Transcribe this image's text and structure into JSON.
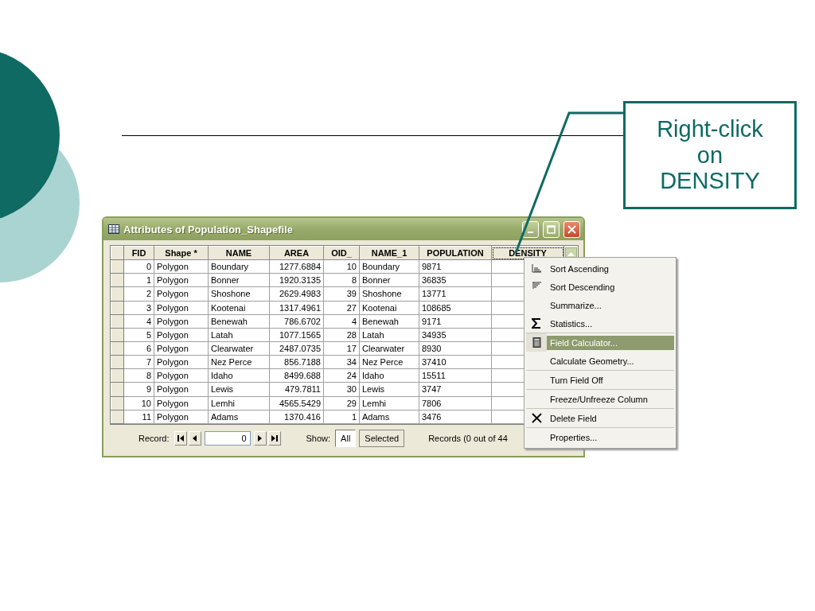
{
  "slide": {
    "callout": {
      "lines": [
        "Right-click",
        "on",
        "DENSITY"
      ]
    }
  },
  "window": {
    "title": "Attributes of Population_Shapefile",
    "table": {
      "columns": [
        {
          "label": "FID",
          "kind": "number",
          "selected": false
        },
        {
          "label": "Shape *",
          "kind": "text",
          "selected": false
        },
        {
          "label": "NAME",
          "kind": "text",
          "selected": false
        },
        {
          "label": "AREA",
          "kind": "number",
          "selected": false
        },
        {
          "label": "OID_",
          "kind": "number",
          "selected": false
        },
        {
          "label": "NAME_1",
          "kind": "text",
          "selected": false
        },
        {
          "label": "POPULATION",
          "kind": "text",
          "selected": false
        },
        {
          "label": "DENSITY",
          "kind": "text",
          "selected": true
        }
      ],
      "rows": [
        [
          "0",
          "Polygon",
          "Boundary",
          "1277.6884",
          "10",
          "Boundary",
          "9871"
        ],
        [
          "1",
          "Polygon",
          "Bonner",
          "1920.3135",
          "8",
          "Bonner",
          "36835"
        ],
        [
          "2",
          "Polygon",
          "Shoshone",
          "2629.4983",
          "39",
          "Shoshone",
          "13771"
        ],
        [
          "3",
          "Polygon",
          "Kootenai",
          "1317.4961",
          "27",
          "Kootenai",
          "108685"
        ],
        [
          "4",
          "Polygon",
          "Benewah",
          "786.6702",
          "4",
          "Benewah",
          "9171"
        ],
        [
          "5",
          "Polygon",
          "Latah",
          "1077.1565",
          "28",
          "Latah",
          "34935"
        ],
        [
          "6",
          "Polygon",
          "Clearwater",
          "2487.0735",
          "17",
          "Clearwater",
          "8930"
        ],
        [
          "7",
          "Polygon",
          "Nez Perce",
          "856.7188",
          "34",
          "Nez Perce",
          "37410"
        ],
        [
          "8",
          "Polygon",
          "Idaho",
          "8499.688",
          "24",
          "Idaho",
          "15511"
        ],
        [
          "9",
          "Polygon",
          "Lewis",
          "479.7811",
          "30",
          "Lewis",
          "3747"
        ],
        [
          "10",
          "Polygon",
          "Lemhi",
          "4565.5429",
          "29",
          "Lemhi",
          "7806"
        ],
        [
          "11",
          "Polygon",
          "Adams",
          "1370.416",
          "1",
          "Adams",
          "3476"
        ]
      ]
    },
    "footer": {
      "record_label": "Record:",
      "record_value": "0",
      "show_label": "Show:",
      "show_buttons": [
        {
          "label": "All",
          "selected": true
        },
        {
          "label": "Selected",
          "selected": false
        }
      ],
      "status": "Records (0 out of 44"
    }
  },
  "context_menu": {
    "groups": [
      [
        {
          "label": "Sort Ascending",
          "kind": "sortup",
          "selected": false
        },
        {
          "label": "Sort Descending",
          "kind": "sortdown",
          "selected": false
        },
        {
          "label": "Summarize...",
          "kind": "plain",
          "selected": false
        },
        {
          "label": "Statistics...",
          "kind": "sigma",
          "selected": false
        }
      ],
      [
        {
          "label": "Field Calculator...",
          "kind": "calculator",
          "selected": true
        },
        {
          "label": "Calculate Geometry...",
          "kind": "plain",
          "selected": false
        }
      ],
      [
        {
          "label": "Turn Field Off",
          "kind": "plain",
          "selected": false
        }
      ],
      [
        {
          "label": "Freeze/Unfreeze Column",
          "kind": "plain",
          "selected": false
        }
      ],
      [
        {
          "label": "Delete Field",
          "kind": "cross",
          "selected": false
        }
      ],
      [
        {
          "label": "Properties...",
          "kind": "plain",
          "selected": false
        }
      ]
    ]
  }
}
